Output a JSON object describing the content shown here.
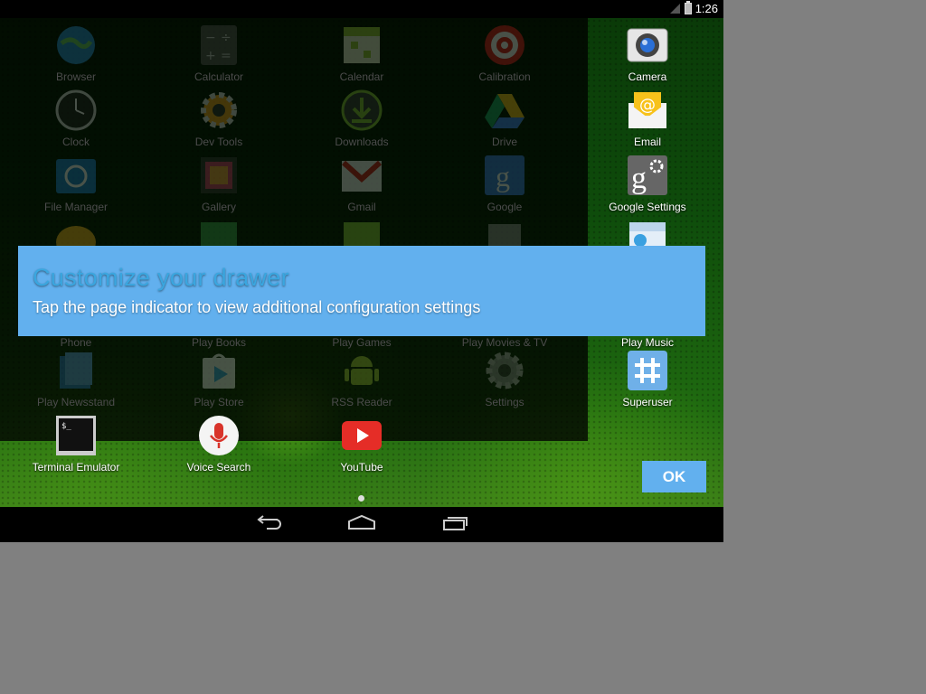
{
  "status_bar": {
    "time": "1:26"
  },
  "drawer_apps": [
    {
      "name": "Browser"
    },
    {
      "name": "Calculator"
    },
    {
      "name": "Calendar"
    },
    {
      "name": "Calibration"
    },
    {
      "name": "Clock"
    },
    {
      "name": "Dev Tools"
    },
    {
      "name": "Downloads"
    },
    {
      "name": "Drive"
    },
    {
      "name": "File Manager"
    },
    {
      "name": "Gallery"
    },
    {
      "name": "Gmail"
    },
    {
      "name": "Google"
    },
    {
      "name": "Phone"
    },
    {
      "name": "Play Books"
    },
    {
      "name": "Play Games"
    },
    {
      "name": "Play Movies & TV"
    },
    {
      "name": "Play Newsstand"
    },
    {
      "name": "Play Store"
    },
    {
      "name": "RSS Reader"
    },
    {
      "name": "Settings"
    },
    {
      "name": "Terminal Emulator"
    },
    {
      "name": "Voice Search"
    },
    {
      "name": "YouTube"
    }
  ],
  "highlight_column": [
    {
      "name": "Camera"
    },
    {
      "name": "Email"
    },
    {
      "name": "Google Settings"
    },
    {
      "name": "Play Music"
    },
    {
      "name": "Superuser"
    }
  ],
  "dialog": {
    "title": "Customize your drawer",
    "message": "Tap the page indicator to view additional configuration settings",
    "ok_label": "OK"
  },
  "colors": {
    "dialog_bg": "#62b0ee",
    "dialog_title": "#3aa6df"
  }
}
